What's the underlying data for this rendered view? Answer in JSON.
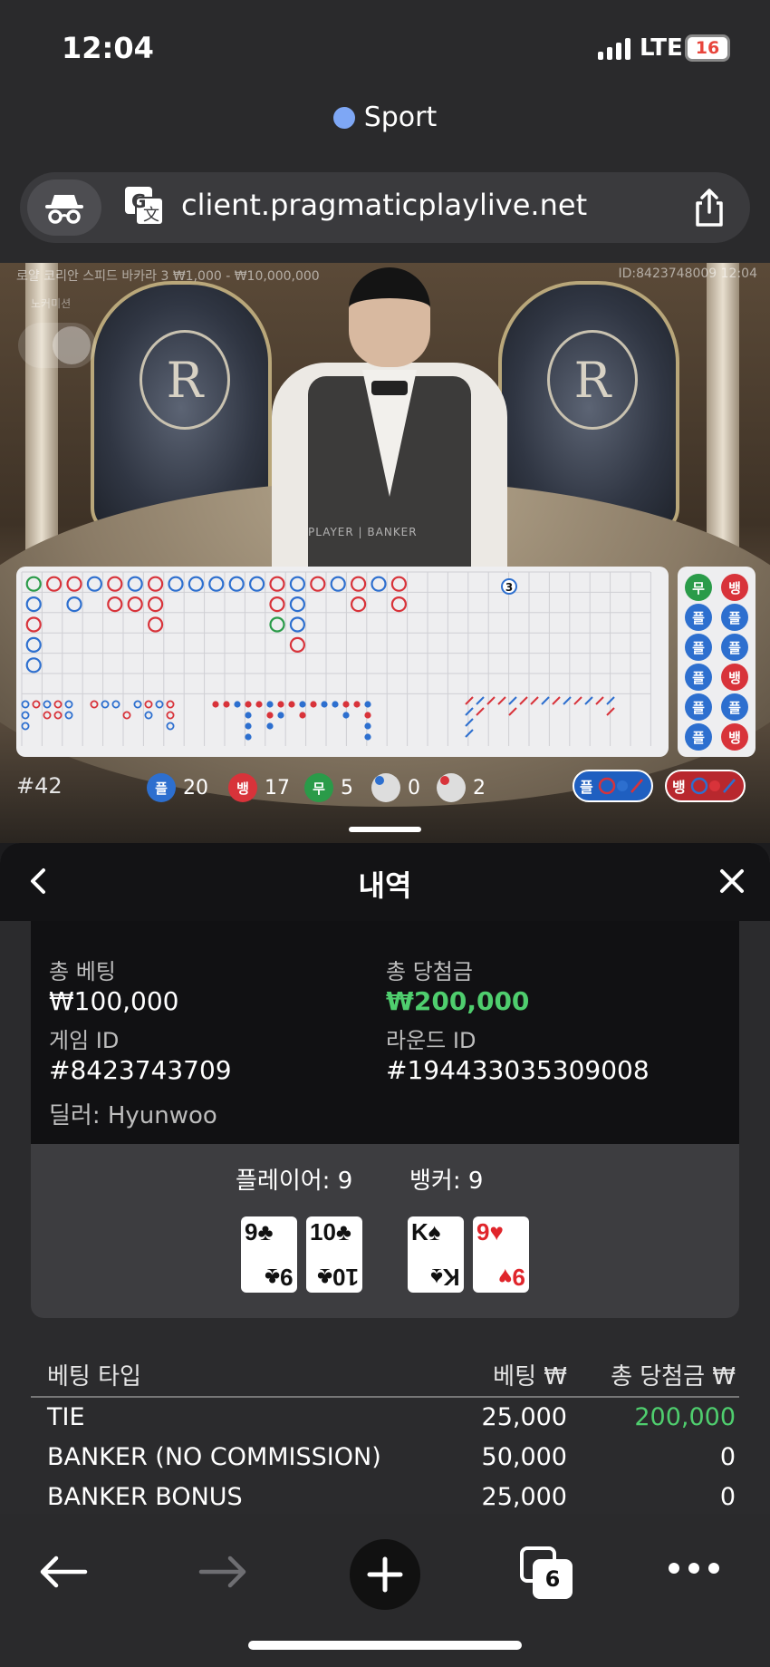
{
  "status_bar": {
    "time": "12:04",
    "network": "LTE",
    "battery": "16"
  },
  "browser": {
    "tab_title": "Sport",
    "url": "client.pragmaticplaylive.net",
    "open_tabs": "6",
    "icons": [
      "incognito-icon",
      "translate-icon",
      "share-icon",
      "back-arrow-icon",
      "forward-arrow-icon",
      "plus-icon",
      "tabs-icon",
      "more-icon"
    ]
  },
  "game": {
    "info": "로얄 코리안 스피드 바카라 3 ₩1,000 - ₩10,000,000",
    "table_id": "ID:8423748009 12:04",
    "sub_label": "노커미션",
    "table_label": "PLAYER | BANKER",
    "emblem_letter": "R"
  },
  "stats": {
    "round": "#42",
    "player_chip": "플",
    "player_count": "20",
    "banker_chip": "뱅",
    "banker_count": "17",
    "tie_chip": "무",
    "tie_count": "5",
    "player_pair_count": "0",
    "banker_pair_count": "2",
    "ask_player": "플",
    "ask_banker": "뱅"
  },
  "side_road": [
    [
      "무",
      "뱅"
    ],
    [
      "플",
      "플"
    ],
    [
      "플",
      "플"
    ],
    [
      "플",
      "뱅"
    ],
    [
      "플",
      "플"
    ],
    [
      "플",
      "뱅"
    ]
  ],
  "bead_badge": "3",
  "history": {
    "title": "내역",
    "total_bet_label": "총 베팅",
    "total_bet": "₩100,000",
    "total_win_label": "총 당첨금",
    "total_win": "₩200,000",
    "game_id_label": "게임 ID",
    "game_id": "#8423743709",
    "round_id_label": "라운드 ID",
    "round_id": "#194433035309008",
    "dealer": "딜러: Hyunwoo",
    "player_label": "플레이어: 9",
    "banker_label": "뱅커: 9",
    "player_cards": [
      {
        "rank": "9",
        "suit": "♣",
        "color": "black"
      },
      {
        "rank": "10",
        "suit": "♣",
        "color": "black"
      }
    ],
    "banker_cards": [
      {
        "rank": "K",
        "suit": "♠",
        "color": "black"
      },
      {
        "rank": "9",
        "suit": "♥",
        "color": "red"
      }
    ],
    "bets_header": {
      "type": "베팅 타입",
      "bet": "베팅 ₩",
      "win": "총 당첨금 ₩"
    },
    "bets": [
      {
        "type": "TIE",
        "bet": "25,000",
        "win": "200,000",
        "won": true
      },
      {
        "type": "BANKER (NO COMMISSION)",
        "bet": "50,000",
        "win": "0",
        "won": false
      },
      {
        "type": "BANKER BONUS",
        "bet": "25,000",
        "win": "0",
        "won": false
      }
    ]
  },
  "colors": {
    "player": "#2d6fcf",
    "banker": "#d8333a",
    "tie": "#2a9b49",
    "win": "#4fce6e"
  }
}
